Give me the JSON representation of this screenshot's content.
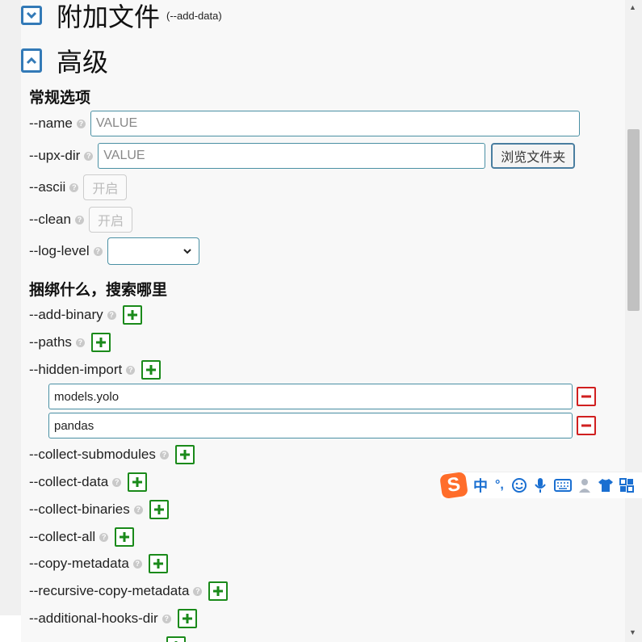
{
  "sections": {
    "additional_files": {
      "title": "附加文件",
      "hint": "(--add-data)"
    },
    "advanced": {
      "title": "高级"
    }
  },
  "general": {
    "title": "常规选项",
    "name": {
      "label": "--name",
      "placeholder": "VALUE"
    },
    "upx_dir": {
      "label": "--upx-dir",
      "placeholder": "VALUE",
      "browse_label": "浏览文件夹"
    },
    "ascii": {
      "label": "--ascii",
      "toggle_label": "开启"
    },
    "clean": {
      "label": "--clean",
      "toggle_label": "开启"
    },
    "log_level": {
      "label": "--log-level",
      "selected": ""
    }
  },
  "bundle": {
    "title": "捆绑什么，搜索哪里",
    "add_binary": "--add-binary",
    "paths": "--paths",
    "hidden_import": {
      "label": "--hidden-import",
      "entries": [
        "models.yolo",
        "pandas"
      ]
    },
    "collect_submodules": "--collect-submodules",
    "collect_data": "--collect-data",
    "collect_binaries": "--collect-binaries",
    "collect_all": "--collect-all",
    "copy_metadata": "--copy-metadata",
    "recursive_copy_metadata": "--recursive-copy-metadata",
    "additional_hooks_dir": "--additional-hooks-dir"
  },
  "help_glyph": "?",
  "ime": {
    "logo": "S",
    "mode": "中",
    "punct": "°,",
    "icons": [
      "smiley-icon",
      "microphone-icon",
      "keyboard-icon",
      "user-icon",
      "shirt-icon",
      "grid-icon"
    ]
  },
  "colors": {
    "accent": "#337ab7",
    "add": "#1a8a1a",
    "remove": "#d01f1f"
  }
}
